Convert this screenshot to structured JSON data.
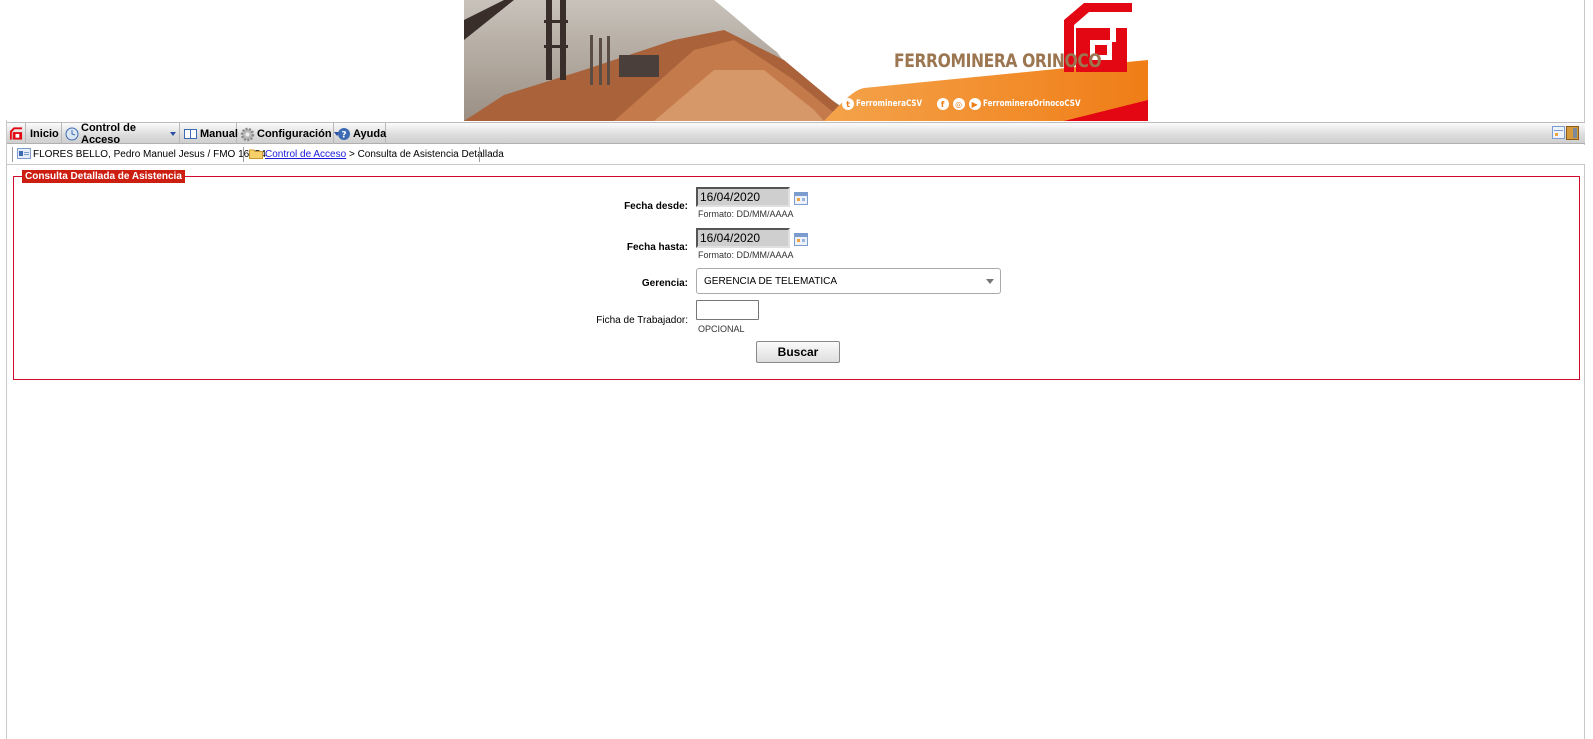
{
  "banner": {
    "brand": "FERROMINERA ORINOCO",
    "social_twitter": "FerromineraCSV",
    "social_youtube": "FerromineraOrinocoCSV"
  },
  "menu": {
    "items": [
      {
        "label": "Inicio",
        "icon": "home-logo-icon"
      },
      {
        "label": "Control de Acceso",
        "icon": "clock-icon",
        "has_dropdown": true
      },
      {
        "label": "Manual",
        "icon": "book-icon"
      },
      {
        "label": "Configuración",
        "icon": "gear-icon",
        "has_dropdown": true
      },
      {
        "label": "Ayuda",
        "icon": "help-icon"
      }
    ]
  },
  "crumb": {
    "user": "FLORES BELLO, Pedro Manuel Jesus / FMO 16554",
    "section_link": "Control de Acceso",
    "current": " > Consulta de Asistencia Detallada"
  },
  "form": {
    "legend": "Consulta Detallada de Asistencia",
    "fecha_desde_label": "Fecha desde:",
    "fecha_desde_value": "16/04/2020",
    "fecha_desde_hint": "Formato: DD/MM/AAAA",
    "fecha_hasta_label": "Fecha hasta:",
    "fecha_hasta_value": "16/04/2020",
    "fecha_hasta_hint": "Formato: DD/MM/AAAA",
    "gerencia_label": "Gerencia:",
    "gerencia_value": "GERENCIA DE TELEMATICA",
    "ficha_label": "Ficha de Trabajador:",
    "ficha_value": "",
    "ficha_hint": "OPCIONAL",
    "submit_label": "Buscar"
  },
  "colors": {
    "brand_red": "#e30613",
    "brand_orange": "#f07d16",
    "legend_bg": "#cc1f12",
    "panel_border": "#d10a2c"
  }
}
